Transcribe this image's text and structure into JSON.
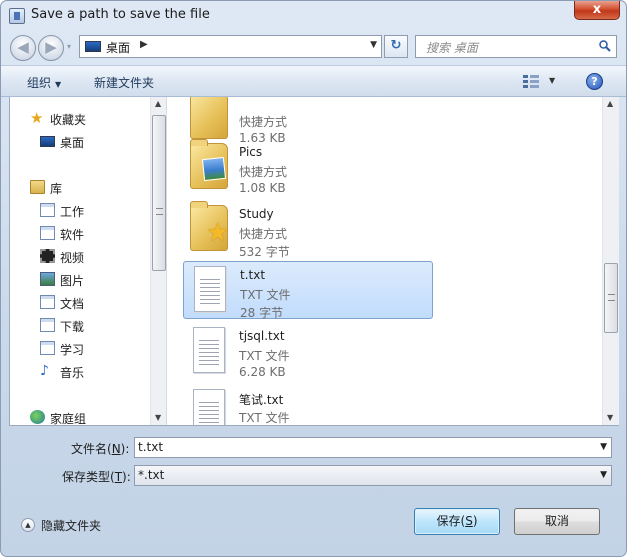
{
  "window": {
    "title": "Save a path to save the file",
    "close_glyph": "x"
  },
  "nav": {
    "back_glyph": "◀",
    "forward_glyph": "▶",
    "history_glyph": "▾",
    "address": {
      "location": "桌面",
      "separator_glyph": "▶",
      "dropdown_glyph": "▼"
    },
    "refresh_glyph": "↻",
    "search_placeholder": "搜索 桌面"
  },
  "toolbar": {
    "organize_label": "组织",
    "organize_arrow": "▼",
    "new_folder_label": "新建文件夹",
    "view_arrow": "▼",
    "help_glyph": "?"
  },
  "sidebar": {
    "items": [
      {
        "label": "收藏夹",
        "icon": "star-icon"
      },
      {
        "label": "桌面",
        "icon": "desktop-icon"
      },
      {
        "label": "库",
        "icon": "library-icon"
      },
      {
        "label": "工作",
        "icon": "document-folder-icon"
      },
      {
        "label": "软件",
        "icon": "document-folder-icon"
      },
      {
        "label": "视频",
        "icon": "video-icon"
      },
      {
        "label": "图片",
        "icon": "picture-icon"
      },
      {
        "label": "文档",
        "icon": "document-icon"
      },
      {
        "label": "下载",
        "icon": "document-folder-icon"
      },
      {
        "label": "学习",
        "icon": "document-folder-icon"
      },
      {
        "label": "音乐",
        "icon": "music-icon"
      },
      {
        "label": "家庭组",
        "icon": "homegroup-icon"
      }
    ],
    "scroll_up": "▲",
    "scroll_down": "▼"
  },
  "files": {
    "items": [
      {
        "name": "",
        "type": "快捷方式",
        "size": "1.63 KB",
        "icon": "folder-shortcut-icon"
      },
      {
        "name": "Pics",
        "type": "快捷方式",
        "size": "1.08 KB",
        "icon": "pictures-folder-icon"
      },
      {
        "name": "Study",
        "type": "快捷方式",
        "size": "532 字节",
        "icon": "favorites-folder-icon"
      },
      {
        "name": "t.txt",
        "type": "TXT 文件",
        "size": "28 字节",
        "icon": "text-file-icon",
        "selected": true
      },
      {
        "name": "tjsql.txt",
        "type": "TXT 文件",
        "size": "6.28 KB",
        "icon": "text-file-icon"
      },
      {
        "name": "笔试.txt",
        "type": "TXT 文件",
        "size": "",
        "icon": "text-file-icon"
      }
    ],
    "scroll_up": "▲",
    "scroll_down": "▼"
  },
  "form": {
    "filename_label_pre": "文件名(",
    "filename_label_key": "N",
    "filename_label_post": "):",
    "filename_value": "t.txt",
    "filetype_label_pre": "保存类型(",
    "filetype_label_key": "T",
    "filetype_label_post": "):",
    "filetype_value": "*.txt",
    "dropdown_glyph": "▼"
  },
  "footer": {
    "hide_folders_glyph": "▲",
    "hide_folders_label": "隐藏文件夹",
    "save_label_pre": "保存(",
    "save_label_key": "S",
    "save_label_post": ")",
    "cancel_label": "取消"
  }
}
